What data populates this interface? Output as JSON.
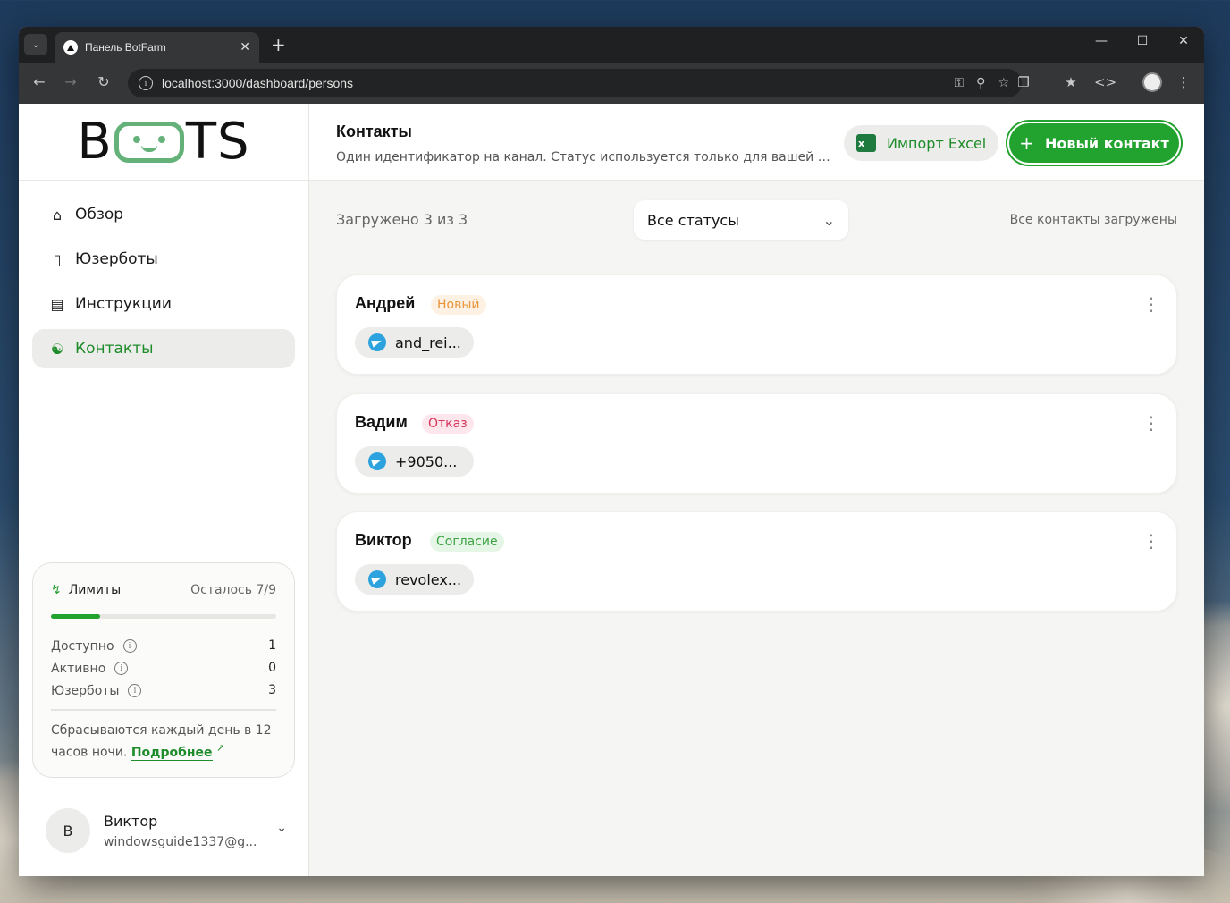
{
  "browser": {
    "tab_title": "Панель BotFarm",
    "url": "localhost:3000/dashboard/persons"
  },
  "logo": {
    "text_left": "B",
    "text_right": "TS"
  },
  "sidebar": {
    "items": [
      {
        "label": "Обзор",
        "icon": "home-icon"
      },
      {
        "label": "Юзерботы",
        "icon": "phone-icon"
      },
      {
        "label": "Инструкции",
        "icon": "document-icon"
      },
      {
        "label": "Контакты",
        "icon": "people-icon",
        "active": true
      }
    ],
    "limits": {
      "title": "Лимиты",
      "remaining": "Осталось 7/9",
      "progress_fraction": 0.22,
      "rows": [
        {
          "label": "Доступно",
          "value": "1"
        },
        {
          "label": "Активно",
          "value": "0"
        },
        {
          "label": "Юзерботы",
          "value": "3"
        }
      ],
      "note": "Сбрасываются каждый день в 12 часов ночи.",
      "link": "Подробнее"
    },
    "user": {
      "initial": "В",
      "name": "Виктор",
      "email": "windowsguide1337@g..."
    }
  },
  "header": {
    "title": "Контакты",
    "subtitle": "Один идентификатор на канал. Статус используется только для вашей вор...",
    "import_label": "Импорт Excel",
    "new_label": "Новый контакт"
  },
  "toolbar": {
    "loaded": "Загружено 3 из 3",
    "status_filter": "Все статусы",
    "all_loaded": "Все контакты загружены"
  },
  "contacts": [
    {
      "name": "Андрей",
      "status": "Новый",
      "channel": "and_rei..."
    },
    {
      "name": "Вадим",
      "status": "Отказ",
      "channel": "+9050..."
    },
    {
      "name": "Виктор",
      "status": "Согласие",
      "channel": "revolex..."
    }
  ],
  "colors": {
    "accent": "#22a22e",
    "badge_new": "#e8953a",
    "badge_refuse": "#d6385c",
    "badge_agree": "#3ca143"
  }
}
